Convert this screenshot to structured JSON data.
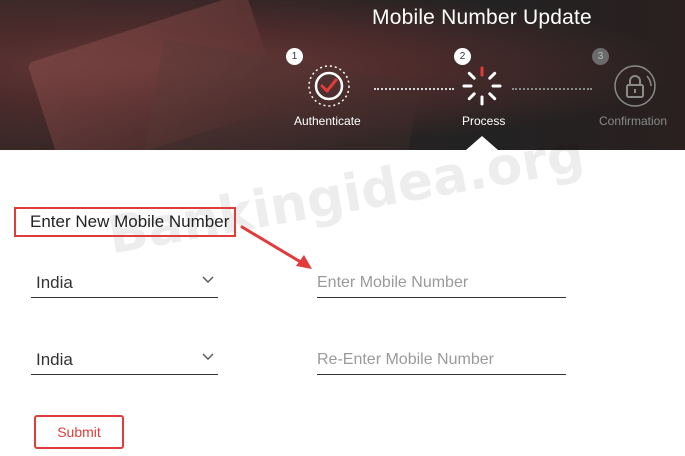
{
  "header": {
    "title": "Mobile Number Update",
    "steps": [
      {
        "number": "1",
        "label": "Authenticate",
        "icon": "check-circle-icon",
        "state": "done"
      },
      {
        "number": "2",
        "label": "Process",
        "icon": "spinner-icon",
        "state": "active"
      },
      {
        "number": "3",
        "label": "Confirmation",
        "icon": "lock-icon",
        "state": "inactive"
      }
    ]
  },
  "watermark": "Bankingidea.org",
  "form": {
    "heading": "Enter New Mobile Number",
    "country1": "India",
    "mobile_placeholder": "Enter Mobile Number",
    "country2": "India",
    "reenter_placeholder": "Re-Enter Mobile Number",
    "submit_label": "Submit"
  },
  "colors": {
    "accent": "#e03c3c",
    "inactive_step": "#8a8a8a"
  }
}
